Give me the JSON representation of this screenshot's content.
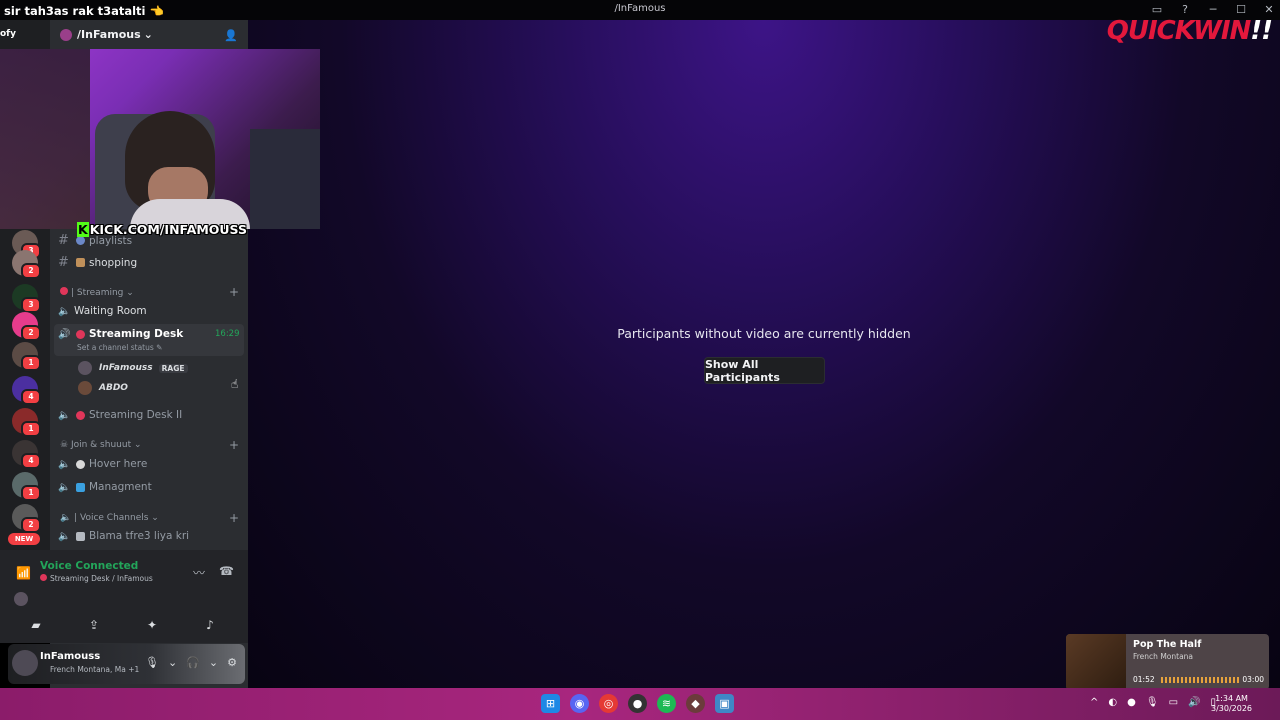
{
  "window": {
    "title": "/InFamous",
    "stream_caption": "sir tah3as rak t3atalti 👈",
    "brand": "QUICKWIN",
    "brand_suffix": "!!"
  },
  "server": {
    "name": "/InFamous",
    "chevron": "⌄",
    "invite_icon": "add-member-icon"
  },
  "overlay": {
    "kick_url": "KICK.COM/INFAMOUSS",
    "prefix_tag": "ofy"
  },
  "rail": {
    "badges": [
      "3",
      "2",
      "3",
      "2",
      "1",
      "4",
      "1",
      "4",
      "1",
      "2"
    ],
    "new_label": "NEW"
  },
  "channels": {
    "playlists": "playlists",
    "shopping": "shopping",
    "cat_streaming": "| Streaming",
    "waiting_room": "Waiting Room",
    "streaming_desk": "Streaming Desk",
    "streaming_desk_time": "16:29",
    "channel_status": "Set a channel status",
    "user1_name": "InFamouss",
    "user1_tag": "RAGE",
    "user2_name": "ABDO",
    "streaming_desk_2": "Streaming Desk II",
    "cat_join": "Join & shuuut",
    "hover_here": "Hover here",
    "managment": "Managment",
    "cat_voice": "| Voice Channels",
    "blama": "Blama tfre3 liya kri"
  },
  "voice": {
    "status": "Voice Connected",
    "location": "Streaming Desk / InFamous"
  },
  "user": {
    "name": "InFamouss",
    "activity": "French Montana, Ma +1"
  },
  "stage": {
    "message": "Participants without video are currently hidden",
    "button": "Show All Participants"
  },
  "music": {
    "song": "Pop The Half",
    "artist": "French Montana",
    "elapsed": "01:52",
    "duration": "03:00",
    "progress": 0.62
  },
  "taskbar": {
    "time": "1:34 AM",
    "date": "3/30/2026"
  },
  "colors": {
    "accent_green": "#23a55a",
    "badge_red": "#f23f43",
    "taskbar": "#a8267e",
    "brand_red": "#e3183c"
  }
}
